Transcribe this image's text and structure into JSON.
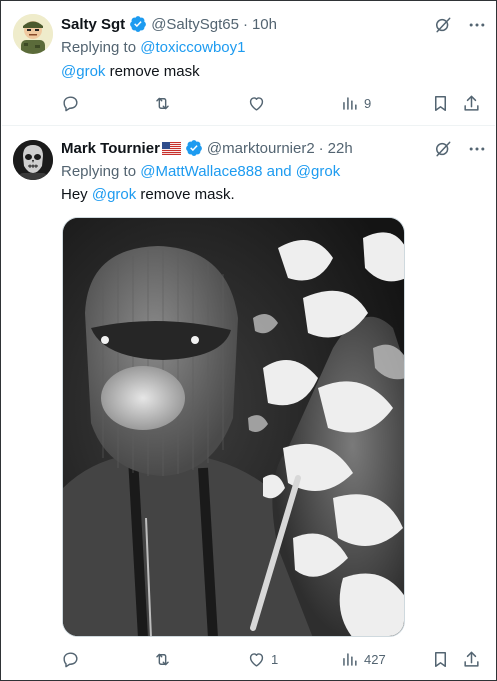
{
  "tweets": [
    {
      "name": "Salty Sgt",
      "handle": "@SaltySgt65",
      "dot": "·",
      "time": "10h",
      "reply_prefix": "Replying to ",
      "reply_users": "@toxiccowboy1",
      "text_mention": "@grok",
      "text_body": " remove mask",
      "counts": {
        "reply": "",
        "retweet": "",
        "like": "",
        "views": "9"
      }
    },
    {
      "name": "Mark Tournier",
      "handle": "@marktournier2",
      "dot": "·",
      "time": "22h",
      "reply_prefix": "Replying to ",
      "reply_users": "@MattWallace888 and @grok",
      "text_prefix": "Hey ",
      "text_mention": "@grok",
      "text_body": " remove mask.",
      "counts": {
        "reply": "",
        "retweet": "",
        "like": "1",
        "views": "427"
      }
    }
  ],
  "icons": {
    "verified": "verified-badge-icon",
    "grok": "grok-icon",
    "more": "more-icon",
    "reply": "reply-icon",
    "retweet": "retweet-icon",
    "like": "like-icon",
    "views": "views-icon",
    "bookmark": "bookmark-icon",
    "share": "share-icon",
    "flag": "us-flag-icon"
  },
  "colors": {
    "accent": "#1d9bf0",
    "secondary_text": "#536471",
    "primary_text": "#0f1419",
    "divider": "#eff3f4"
  }
}
